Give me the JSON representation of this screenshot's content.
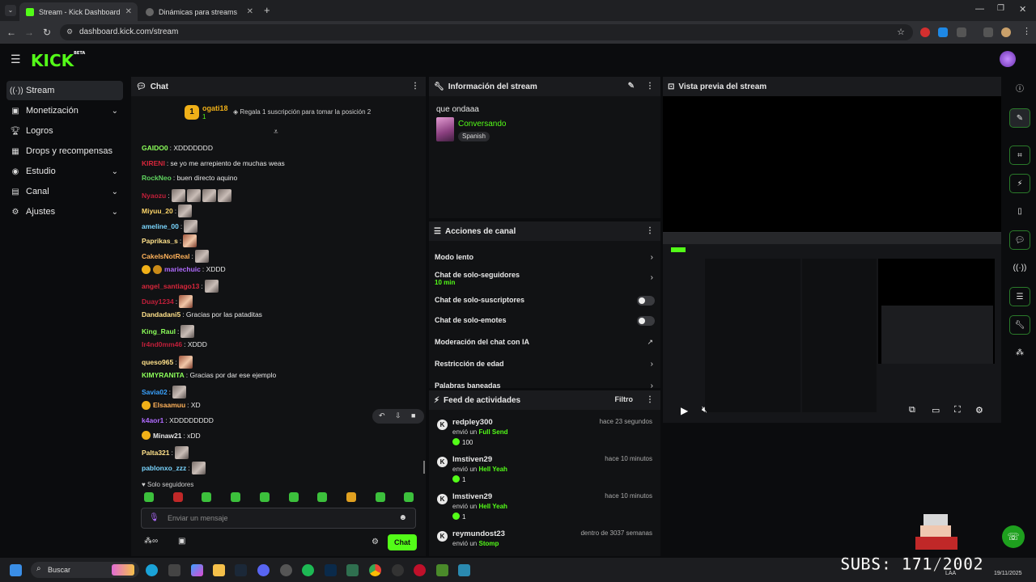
{
  "browser": {
    "tabs": [
      {
        "label": "Stream - Kick Dashboard",
        "active": true
      },
      {
        "label": "Dinámicas para streams",
        "active": false
      }
    ],
    "new_tab": "+",
    "url": "dashboard.kick.com/stream"
  },
  "app": {
    "logo": "KICK",
    "logo_badge": "BETA"
  },
  "sidebar": {
    "items": [
      {
        "label": "Stream",
        "icon": "stream-icon",
        "active": true
      },
      {
        "label": "Monetización",
        "icon": "dollar-icon",
        "chevron": true
      },
      {
        "label": "Logros",
        "icon": "trophy-icon"
      },
      {
        "label": "Drops y recompensas",
        "icon": "gift-icon"
      },
      {
        "label": "Estudio",
        "icon": "studio-icon",
        "chevron": true
      },
      {
        "label": "Canal",
        "icon": "channel-icon",
        "chevron": true
      },
      {
        "label": "Ajustes",
        "icon": "gear-icon",
        "chevron": true
      }
    ]
  },
  "chat": {
    "title": "Chat",
    "top_gifter": {
      "name": "ogati18",
      "rank": "1",
      "count": "1",
      "cta": "Regala 1 suscripción para tomar la posición 2"
    },
    "messages": [
      {
        "user": "GAIDO0",
        "color": "#8cff5a",
        "text": ": XDDDDDDD"
      },
      {
        "user": "KIRENI",
        "color": "#d8263b",
        "text": ": se yo me arrepiento de muchas weas"
      },
      {
        "user": "RockNeo",
        "color": "#5fd35f",
        "text": ": buen directo aquino"
      },
      {
        "user": "Nyaozu",
        "color": "#c21f3a",
        "text": ":",
        "emotes": 4
      },
      {
        "user": "Miyuu_20",
        "color": "#ffd76a",
        "text": ":",
        "emotes": 1
      },
      {
        "user": "ameline_00",
        "color": "#7ad6ff",
        "text": ":",
        "emotes": 1
      },
      {
        "user": "Paprikas_s",
        "color": "#ffe18a",
        "text": ":",
        "emotes": 1
      },
      {
        "user": "CakeIsNotReal",
        "color": "#ffb25a",
        "text": ":",
        "emotes": 1
      },
      {
        "user": "mariechuic",
        "color": "#b06bff",
        "text": ": XDDD",
        "badges": 2
      },
      {
        "user": "angel_santiago13",
        "color": "#d8263b",
        "text": ":",
        "emotes": 1
      },
      {
        "user": "Duay1234",
        "color": "#c21f3a",
        "text": ":",
        "emotes": 1
      },
      {
        "user": "Dandadani5",
        "color": "#ffe18a",
        "text": ": Gracias por las pataditas"
      },
      {
        "user": "King_Raul",
        "color": "#8cff5a",
        "text": ":",
        "emotes": 1
      },
      {
        "user": "Ir4nd0mm46",
        "color": "#c21f3a",
        "text": ": XDDD"
      },
      {
        "user": "queso965",
        "color": "#ffe18a",
        "text": ":",
        "emotes": 1
      },
      {
        "user": "KIMYRANITA",
        "color": "#8cff5a",
        "text": ": Gracias por dar ese ejemplo"
      },
      {
        "user": "Savia02",
        "color": "#3aa3ff",
        "text": ":",
        "emotes": 1
      },
      {
        "user": "Elsaamuu",
        "color": "#ffb25a",
        "text": ": XD",
        "badges": 1
      },
      {
        "user": "k4aor1",
        "color": "#b06bff",
        "text": ": XDDDDDDDD"
      },
      {
        "user": "Minaw21",
        "color": "#e8e8e8",
        "text": ": xDD",
        "badges": 1
      },
      {
        "user": "Palta321",
        "color": "#ffe18a",
        "text": ":",
        "emotes": 1
      },
      {
        "user": "pablonxo_zzz",
        "color": "#7ad6ff",
        "text": ":",
        "emotes": 1
      }
    ],
    "followers_only": "Solo seguidores",
    "input_placeholder": "Enviar un mensaje",
    "send_label": "Chat"
  },
  "stream_info": {
    "title": "Información del stream",
    "stream_title": "que ondaaa",
    "category": "Conversando",
    "language": "Spanish"
  },
  "channel_actions": {
    "title": "Acciones de canal",
    "items": [
      {
        "label": "Modo lento",
        "kind": "chevron"
      },
      {
        "label": "Chat de solo-seguidores",
        "sub": "10 min",
        "kind": "chevron"
      },
      {
        "label": "Chat de solo-suscriptores",
        "kind": "toggle"
      },
      {
        "label": "Chat de solo-emotes",
        "kind": "toggle"
      },
      {
        "label": "Moderación del chat con IA",
        "kind": "external"
      },
      {
        "label": "Restricción de edad",
        "kind": "chevron"
      },
      {
        "label": "Palabras baneadas",
        "kind": "chevron"
      }
    ]
  },
  "activity_feed": {
    "title": "Feed de actividades",
    "filter_label": "Filtro",
    "events": [
      {
        "user": "redpley300",
        "time": "hace 23 segundos",
        "action": "envió un",
        "item": "Full Send",
        "amount": "100"
      },
      {
        "user": "lmstiven29",
        "time": "hace 10 minutos",
        "action": "envió un",
        "item": "Hell Yeah",
        "amount": "1"
      },
      {
        "user": "lmstiven29",
        "time": "hace 10 minutos",
        "action": "envió un",
        "item": "Hell Yeah",
        "amount": "1"
      },
      {
        "user": "reymundost23",
        "time": "dentro de 3037 semanas",
        "action": "envió un",
        "item": "Stomp",
        "amount": ""
      }
    ]
  },
  "preview": {
    "title": "Vista previa del stream"
  },
  "overlay": {
    "subs_counter": "SUBS: 171/2002"
  },
  "taskbar": {
    "search_placeholder": "Buscar",
    "lang": "LAA",
    "date": "19/11/2025"
  },
  "colors": {
    "accent": "#53fc18",
    "panel_bg": "#111214",
    "header_bg": "#1a1b1e"
  }
}
